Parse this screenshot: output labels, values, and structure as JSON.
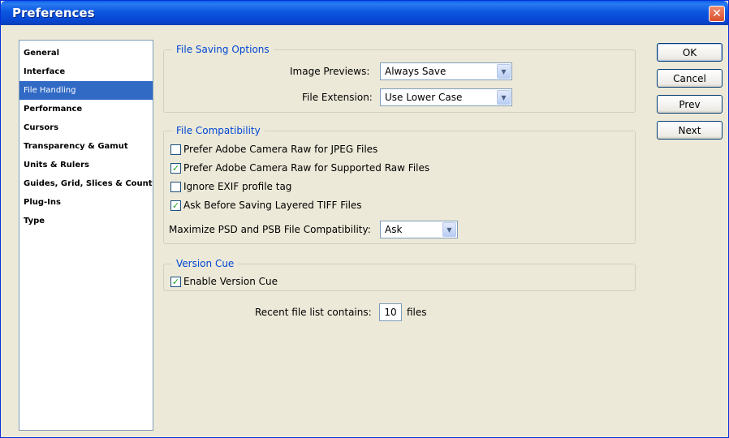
{
  "window": {
    "title": "Preferences",
    "close_glyph": "✕"
  },
  "sidebar": {
    "items": [
      {
        "label": "General"
      },
      {
        "label": "Interface"
      },
      {
        "label": "File Handling",
        "selected": true
      },
      {
        "label": "Performance"
      },
      {
        "label": "Cursors"
      },
      {
        "label": "Transparency & Gamut"
      },
      {
        "label": "Units & Rulers"
      },
      {
        "label": "Guides, Grid, Slices & Count"
      },
      {
        "label": "Plug-Ins"
      },
      {
        "label": "Type"
      }
    ]
  },
  "file_saving": {
    "title": "File Saving Options",
    "image_previews_label": "Image Previews:",
    "image_previews_value": "Always Save",
    "file_extension_label": "File Extension:",
    "file_extension_value": "Use Lower Case"
  },
  "file_compat": {
    "title": "File Compatibility",
    "options": [
      {
        "label": "Prefer Adobe Camera Raw for JPEG Files",
        "checked": false
      },
      {
        "label": "Prefer Adobe Camera Raw for Supported Raw Files",
        "checked": true
      },
      {
        "label": "Ignore EXIF profile tag",
        "checked": false
      },
      {
        "label": "Ask Before Saving Layered TIFF Files",
        "checked": true
      }
    ],
    "maximize_label": "Maximize PSD and PSB File Compatibility:",
    "maximize_value": "Ask"
  },
  "version_cue": {
    "title": "Version Cue",
    "enable_label": "Enable Version Cue",
    "enable_checked": true
  },
  "recent": {
    "label": "Recent file list contains:",
    "value": "10",
    "suffix": "files"
  },
  "buttons": {
    "ok": "OK",
    "cancel": "Cancel",
    "prev": "Prev",
    "next": "Next"
  },
  "colors": {
    "titlebar": "#0a5ee8",
    "selection": "#316ac5",
    "group_title": "#0046d5",
    "check_mark": "#21a121"
  },
  "icons": {
    "check": "✓",
    "dropdown": "▼"
  }
}
